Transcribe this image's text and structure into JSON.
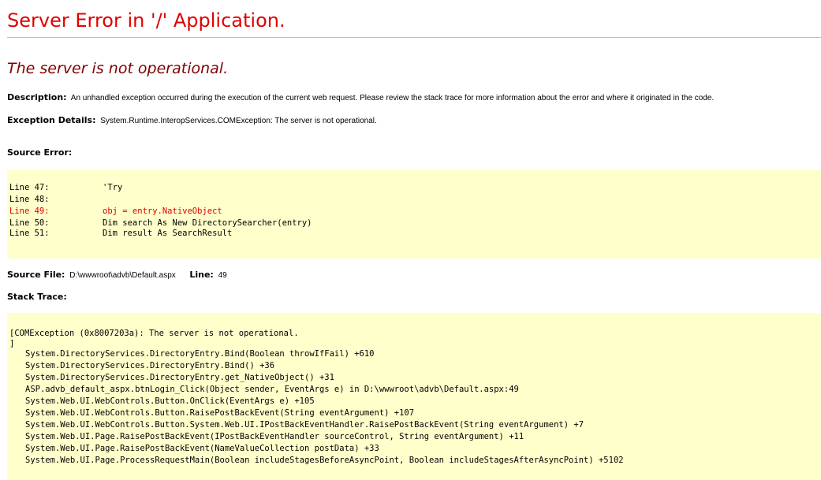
{
  "error_title": "Server Error in '/' Application.",
  "error_message": "The server is not operational.",
  "description": {
    "label": "Description:",
    "text": "An unhandled exception occurred during the execution of the current web request. Please review the stack trace for more information about the error and where it originated in the code."
  },
  "exception_details": {
    "label": "Exception Details:",
    "text": "System.Runtime.InteropServices.COMException: The server is not operational."
  },
  "source_error": {
    "label": "Source Error:",
    "lines": [
      {
        "number": "Line 47:",
        "code": "'Try"
      },
      {
        "number": "Line 48:",
        "code": ""
      },
      {
        "number": "Line 49:",
        "code": "obj = entry.NativeObject"
      },
      {
        "number": "Line 50:",
        "code": "Dim search As New DirectorySearcher(entry)"
      },
      {
        "number": "Line 51:",
        "code": "Dim result As SearchResult"
      }
    ],
    "highlight_color": "#e00000",
    "background_color": "#ffffcc"
  },
  "source_file": {
    "label": "Source File:",
    "path": "D:\\wwwroot\\advb\\Default.aspx",
    "line_label": "Line:",
    "line_value": "49"
  },
  "stack_trace": {
    "label": "Stack Trace:",
    "header": "[COMException (0x8007203a): The server is not operational.",
    "closing": "]",
    "frames": [
      "System.DirectoryServices.DirectoryEntry.Bind(Boolean throwIfFail) +610",
      "System.DirectoryServices.DirectoryEntry.Bind() +36",
      "System.DirectoryServices.DirectoryEntry.get_NativeObject() +31",
      "ASP.advb_default_aspx.btnLogin_Click(Object sender, EventArgs e) in D:\\wwwroot\\advb\\Default.aspx:49",
      "System.Web.UI.WebControls.Button.OnClick(EventArgs e) +105",
      "System.Web.UI.WebControls.Button.RaisePostBackEvent(String eventArgument) +107",
      "System.Web.UI.WebControls.Button.System.Web.UI.IPostBackEventHandler.RaisePostBackEvent(String eventArgument) +7",
      "System.Web.UI.Page.RaisePostBackEvent(IPostBackEventHandler sourceControl, String eventArgument) +11",
      "System.Web.UI.Page.RaisePostBackEvent(NameValueCollection postData) +33",
      "System.Web.UI.Page.ProcessRequestMain(Boolean includeStagesBeforeAsyncPoint, Boolean includeStagesAfterAsyncPoint) +5102"
    ]
  },
  "colors": {
    "title": "#e00000",
    "message": "#800000",
    "code_background": "#ffffcc"
  }
}
